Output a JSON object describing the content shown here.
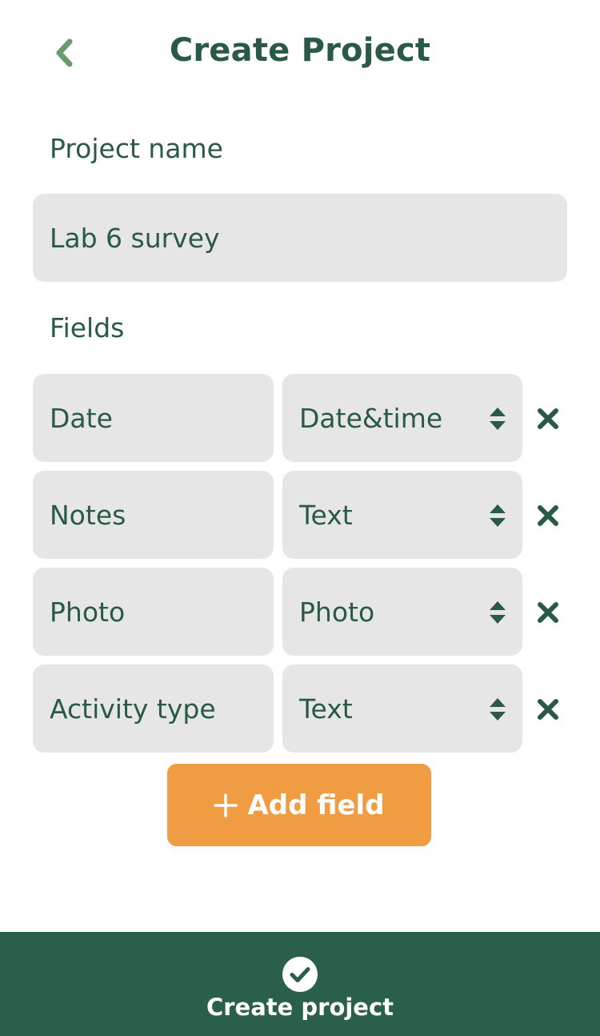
{
  "header": {
    "title": "Create Project",
    "back_icon": "chevron-left-icon"
  },
  "project_name": {
    "label": "Project name",
    "value": "Lab 6 survey"
  },
  "fields_section": {
    "label": "Fields",
    "rows": [
      {
        "name": "Date",
        "type": "Date&time"
      },
      {
        "name": "Notes",
        "type": "Text"
      },
      {
        "name": "Photo",
        "type": "Photo"
      },
      {
        "name": "Activity type",
        "type": "Text"
      }
    ]
  },
  "add_field": {
    "label": "Add field",
    "icon": "plus-icon"
  },
  "footer": {
    "label": "Create project",
    "icon": "check-circle-icon"
  },
  "colors": {
    "primary": "#2a5a45",
    "accent": "#f09c42",
    "back_chevron": "#6a9b6e",
    "input_bg": "#e6e6e6",
    "footer_bg": "#2a5f49"
  }
}
